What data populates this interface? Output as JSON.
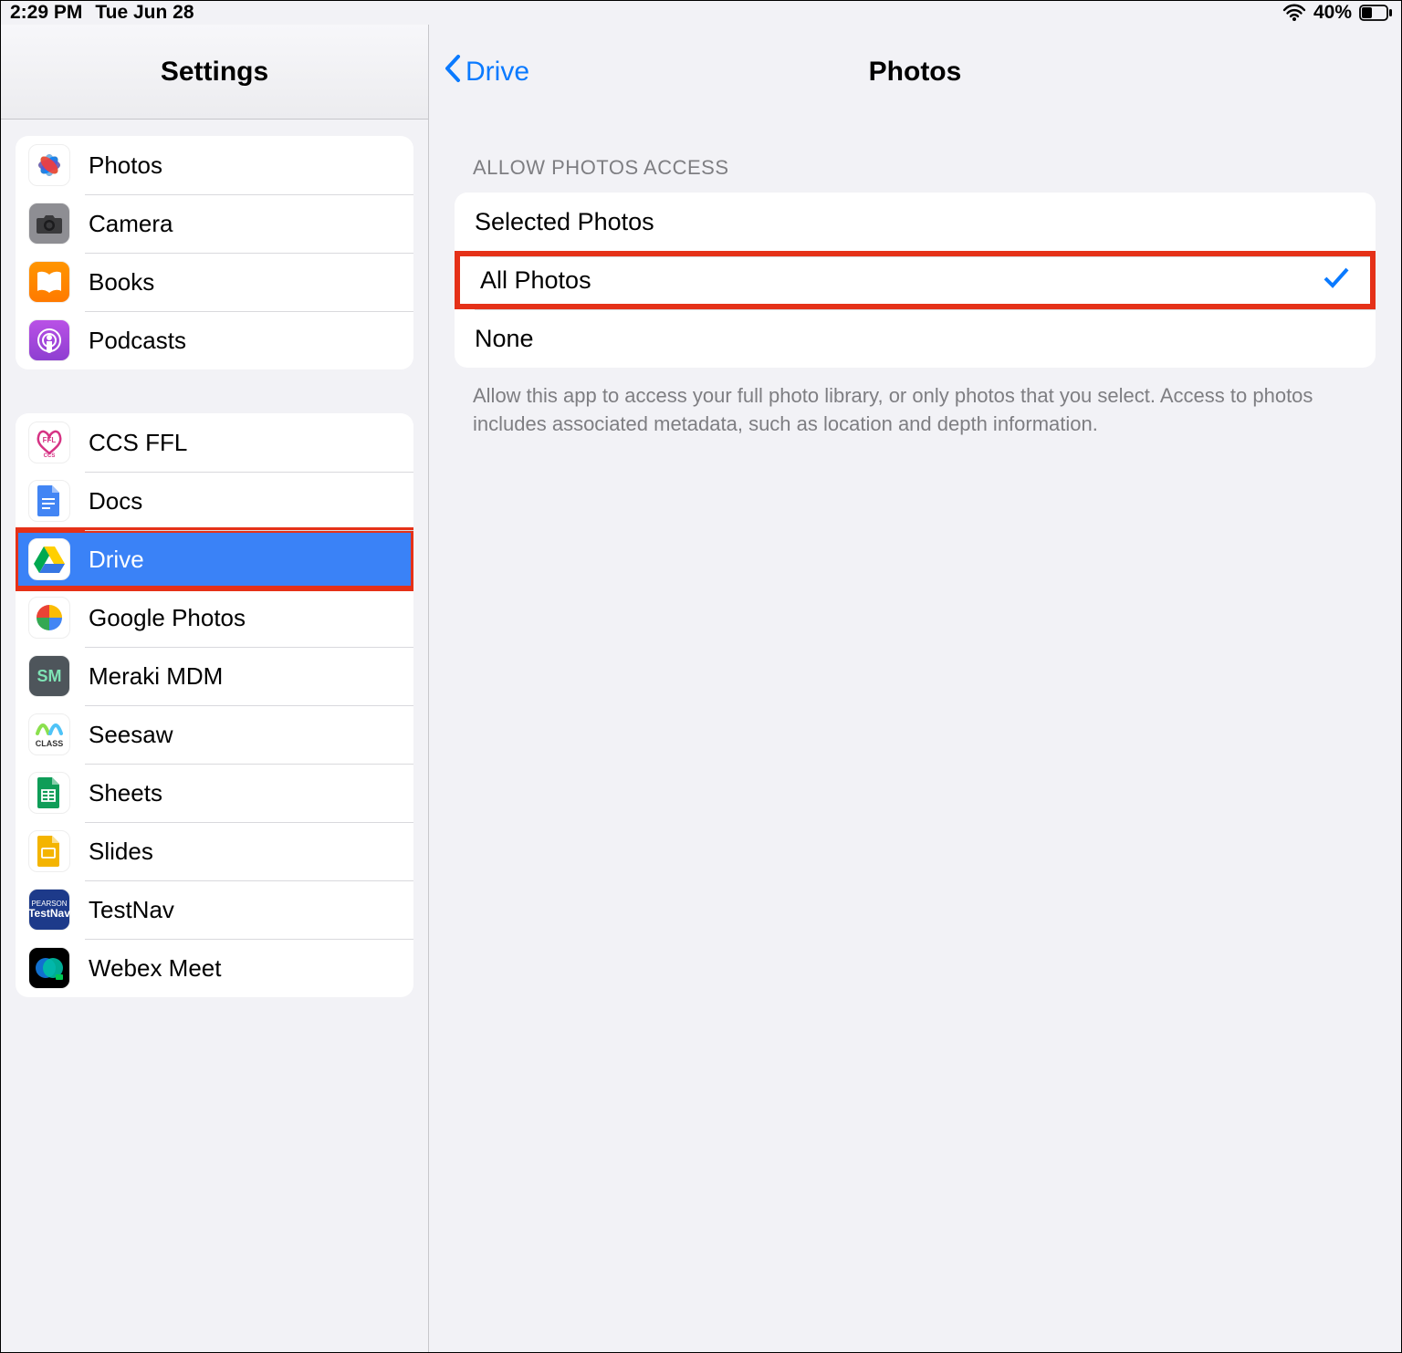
{
  "status": {
    "time": "2:29 PM",
    "date": "Tue Jun 28",
    "battery_pct": "40%"
  },
  "sidebar": {
    "title": "Settings",
    "groups": [
      {
        "items": [
          {
            "label": "Photos",
            "icon": "photos-app-icon"
          },
          {
            "label": "Camera",
            "icon": "camera-app-icon"
          },
          {
            "label": "Books",
            "icon": "books-app-icon"
          },
          {
            "label": "Podcasts",
            "icon": "podcasts-app-icon"
          }
        ]
      },
      {
        "items": [
          {
            "label": "CCS FFL",
            "icon": "ccs-ffl-app-icon"
          },
          {
            "label": "Docs",
            "icon": "google-docs-app-icon"
          },
          {
            "label": "Drive",
            "icon": "google-drive-app-icon",
            "selected": true,
            "highlighted": true
          },
          {
            "label": "Google Photos",
            "icon": "google-photos-app-icon"
          },
          {
            "label": "Meraki MDM",
            "icon": "meraki-mdm-app-icon"
          },
          {
            "label": "Seesaw",
            "icon": "seesaw-app-icon"
          },
          {
            "label": "Sheets",
            "icon": "google-sheets-app-icon"
          },
          {
            "label": "Slides",
            "icon": "google-slides-app-icon"
          },
          {
            "label": "TestNav",
            "icon": "testnav-app-icon"
          },
          {
            "label": "Webex Meet",
            "icon": "webex-meet-app-icon"
          }
        ]
      }
    ]
  },
  "detail": {
    "back_label": "Drive",
    "title": "Photos",
    "section_header": "ALLOW PHOTOS ACCESS",
    "options": [
      {
        "label": "Selected Photos",
        "checked": false
      },
      {
        "label": "All Photos",
        "checked": true,
        "highlighted": true
      },
      {
        "label": "None",
        "checked": false
      }
    ],
    "footer": "Allow this app to access your full photo library, or only photos that you select. Access to photos includes associated metadata, such as location and depth information."
  }
}
